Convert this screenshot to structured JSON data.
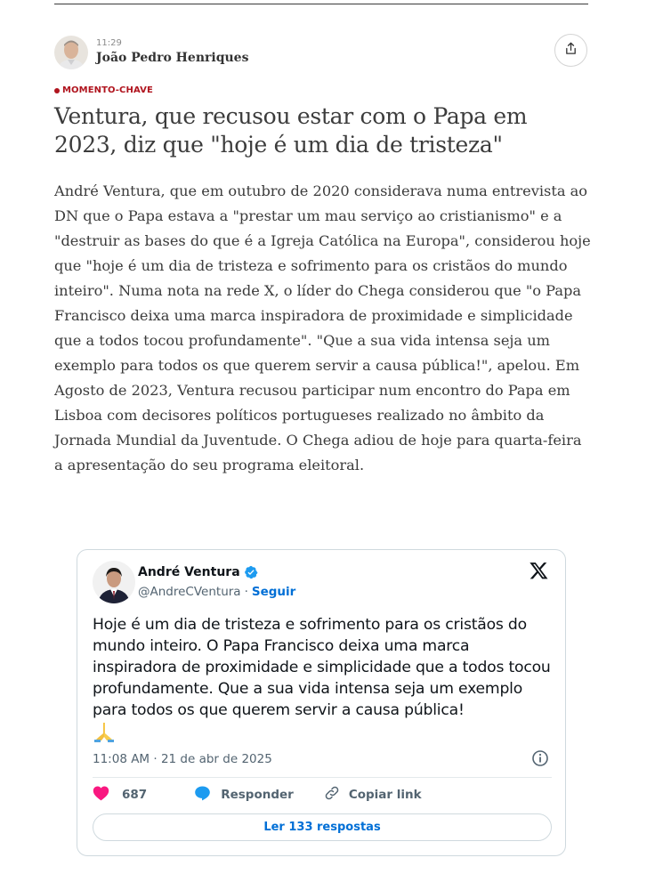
{
  "author": {
    "time": "11:29",
    "name": "João Pedro Henriques"
  },
  "article": {
    "tag": "MOMENTO-CHAVE",
    "headline": "Ventura, que recusou estar com o Papa em 2023, diz que \"hoje é um dia de tristeza\"",
    "body": "André Ventura, que em outubro de 2020 considerava numa entrevista ao DN que o Papa estava a \"prestar um mau serviço ao cristianismo\" e a \"destruir as bases do que é a Igreja Católica na Europa\", considerou hoje que \"hoje é um dia de tristeza e sofrimento para os cristãos do mundo inteiro\". Numa nota na rede X, o líder do Chega considerou que \"o Papa Francisco deixa uma marca inspiradora de proximidade e simplicidade que a todos tocou profundamente\". \"Que a sua vida intensa seja um exemplo para todos os que querem servir a causa pública!\", apelou. Em Agosto de 2023, Ventura recusou participar num encontro do Papa em Lisboa com decisores políticos portugueses realizado no âmbito da Jornada Mundial da Juventude. O Chega adiou de hoje para quarta-feira a apresentação do seu programa eleitoral."
  },
  "tweet": {
    "name": "André Ventura",
    "handle": "@AndreCVentura",
    "separator": "·",
    "follow_label": "Seguir",
    "text": "Hoje é um dia de tristeza e sofrimento para os cristãos do mundo inteiro. O Papa Francisco deixa uma marca inspiradora de proximidade e simplicidade que a todos tocou profundamente. Que a sua vida intensa seja um exemplo para todos os que querem servir a causa pública!",
    "emoji": "🙏",
    "timestamp": "11:08 AM · 21 de abr de 2025",
    "likes": "687",
    "reply_label": "Responder",
    "copy_link_label": "Copiar link",
    "read_replies_label": "Ler 133 respostas"
  },
  "icons": {
    "share": "share-icon",
    "verified": "verified-badge-icon",
    "x_logo": "x-logo-icon",
    "info": "info-icon",
    "heart": "heart-icon",
    "reply": "reply-bubble-icon",
    "link": "link-icon"
  },
  "colors": {
    "tag_red": "#b0141e",
    "link_blue": "#006fd6",
    "heart_pink": "#f91880",
    "verified_blue": "#1d9bf0"
  }
}
